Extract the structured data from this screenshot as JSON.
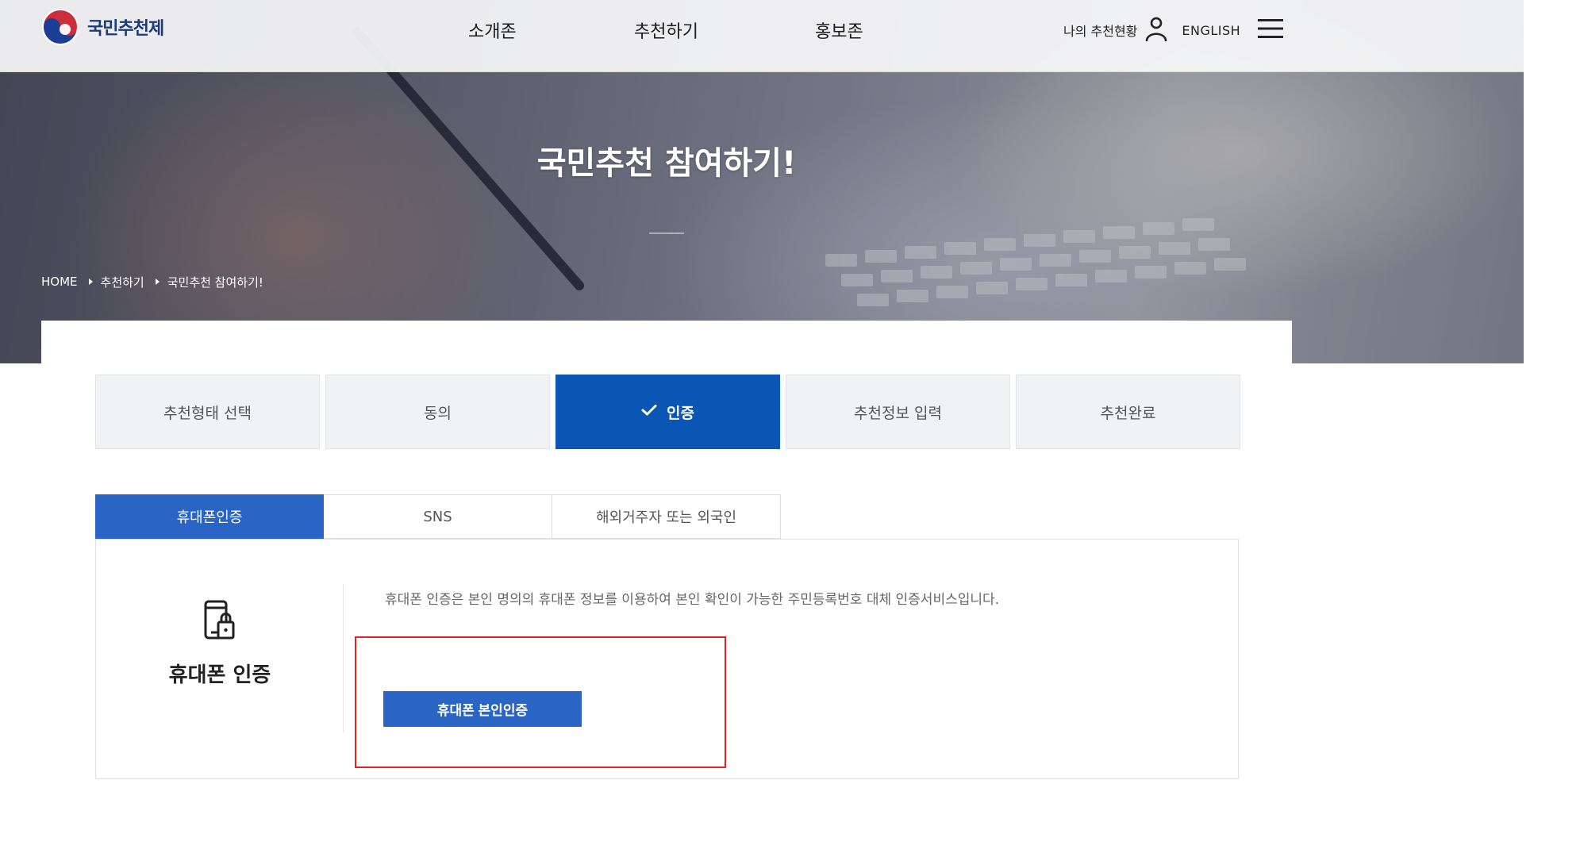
{
  "header": {
    "logo_text": "국민추천제",
    "nav": [
      "소개존",
      "추천하기",
      "홍보존"
    ],
    "my_status": "나의 추천현황",
    "english": "ENGLISH"
  },
  "hero": {
    "title": "국민추천 참여하기!",
    "breadcrumb": [
      "HOME",
      "추천하기",
      "국민추천 참여하기!"
    ]
  },
  "steps": [
    "추천형태 선택",
    "동의",
    "인증",
    "추천정보 입력",
    "추천완료"
  ],
  "steps_active_index": 2,
  "tabs": [
    "휴대폰인증",
    "SNS",
    "해외거주자 또는 외국인"
  ],
  "tabs_active_index": 0,
  "panel": {
    "title": "휴대폰 인증",
    "description": "휴대폰 인증은 본인 명의의 휴대폰 정보를 이용하여 본인 확인이 가능한 주민등록번호 대체 인증서비스입니다.",
    "button_label": "휴대폰 본인인증"
  },
  "colors": {
    "primary": "#0b55b4",
    "tab_active": "#2a64c4",
    "highlight": "#e02424"
  },
  "icons": {
    "logo": "taegeuk-emblem-icon",
    "user": "user-icon",
    "menu": "hamburger-menu-icon",
    "check": "check-icon",
    "phone": "phone-lock-icon"
  }
}
